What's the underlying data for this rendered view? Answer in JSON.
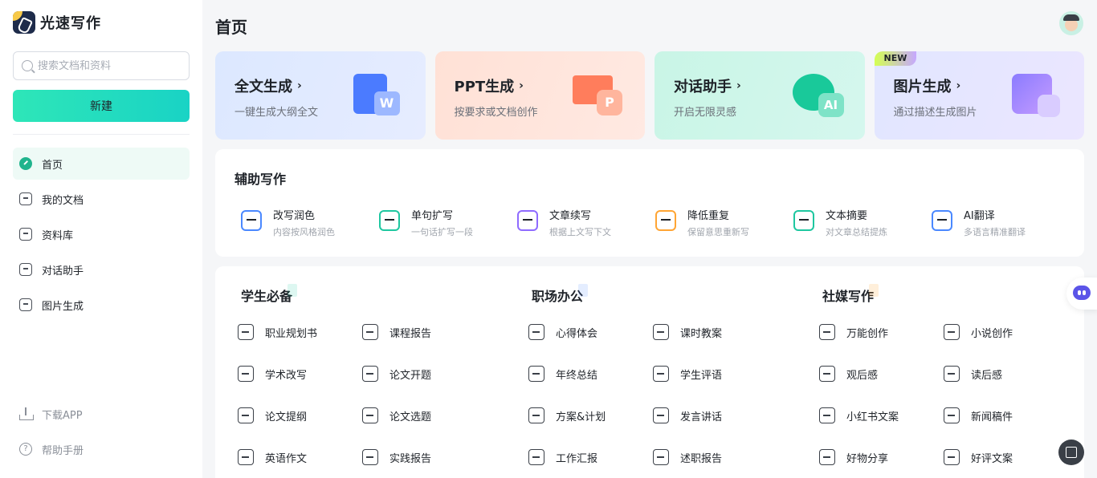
{
  "app": {
    "name": "光速写作"
  },
  "search": {
    "placeholder": "搜索文档和资料"
  },
  "new_button": "新建",
  "nav": [
    {
      "label": "首页",
      "icon": "home-icon",
      "active": true
    },
    {
      "label": "我的文档",
      "icon": "document-icon"
    },
    {
      "label": "资料库",
      "icon": "library-icon"
    },
    {
      "label": "对话助手",
      "icon": "chat-icon"
    },
    {
      "label": "图片生成",
      "icon": "image-icon"
    }
  ],
  "bottom_links": [
    {
      "label": "下载APP",
      "icon": "download-icon"
    },
    {
      "label": "帮助手册",
      "icon": "help-icon"
    }
  ],
  "page_title": "首页",
  "feature_cards": [
    {
      "title": "全文生成",
      "subtitle": "一键生成大纲全文",
      "badge_text": "W"
    },
    {
      "title": "PPT生成",
      "subtitle": "按要求或文档创作",
      "badge_text": "P"
    },
    {
      "title": "对话助手",
      "subtitle": "开启无限灵感",
      "badge_text": "AI"
    },
    {
      "title": "图片生成",
      "subtitle": "通过描述生成图片",
      "badge": "NEW"
    }
  ],
  "assist": {
    "title": "辅助写作",
    "items": [
      {
        "title": "改写润色",
        "subtitle": "内容按风格润色"
      },
      {
        "title": "单句扩写",
        "subtitle": "一句话扩写一段"
      },
      {
        "title": "文章续写",
        "subtitle": "根据上文写下文"
      },
      {
        "title": "降低重复",
        "subtitle": "保留意思重新写"
      },
      {
        "title": "文本摘要",
        "subtitle": "对文章总结提炼"
      },
      {
        "title": "AI翻译",
        "subtitle": "多语言精准翻译"
      }
    ]
  },
  "sections": [
    {
      "title": "学生必备",
      "items": [
        "职业规划书",
        "课程报告",
        "学术改写",
        "论文开题",
        "论文提纲",
        "论文选题",
        "英语作文",
        "实践报告"
      ]
    },
    {
      "title": "职场办公",
      "items": [
        "心得体会",
        "课时教案",
        "年终总结",
        "学生评语",
        "方案&计划",
        "发言讲话",
        "工作汇报",
        "述职报告"
      ]
    },
    {
      "title": "社媒写作",
      "items": [
        "万能创作",
        "小说创作",
        "观后感",
        "读后感",
        "小红书文案",
        "新闻稿件",
        "好物分享",
        "好评文案"
      ]
    }
  ]
}
